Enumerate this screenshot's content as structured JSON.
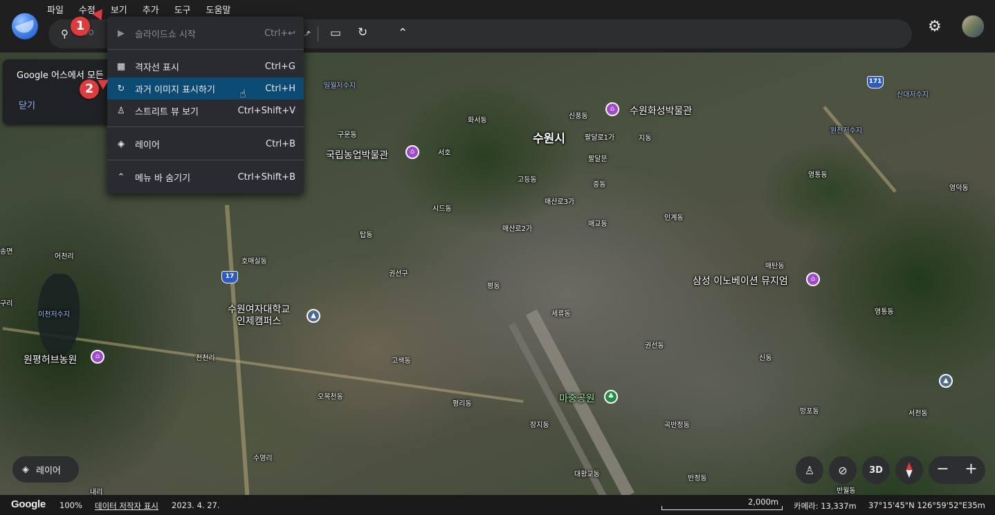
{
  "menubar": {
    "items": [
      "파일",
      "수정",
      "보기",
      "추가",
      "도구",
      "도움말"
    ]
  },
  "search": {
    "placeholder": "Goo"
  },
  "info_panel": {
    "text": "Google 어스에서 모든",
    "close_label": "닫기"
  },
  "view_menu": {
    "items": [
      {
        "icon": "slideshow-icon",
        "label": "슬라이드쇼 시작",
        "shortcut": "Ctrl+↩",
        "disabled": true
      },
      {
        "icon": "grid-icon",
        "label": "격자선 표시",
        "shortcut": "Ctrl+G"
      },
      {
        "icon": "history-icon",
        "label": "과거 이미지 표시하기",
        "shortcut": "Ctrl+H",
        "highlighted": true
      },
      {
        "icon": "pegman-icon",
        "label": "스트리트 뷰 보기",
        "shortcut": "Ctrl+Shift+V"
      },
      {
        "icon": "layers-icon",
        "label": "레이어",
        "shortcut": "Ctrl+B"
      },
      {
        "icon": "chevron-up-icon",
        "label": "메뉴 바 숨기기",
        "shortcut": "Ctrl+Shift+B"
      }
    ]
  },
  "annotations": {
    "marker1": "1",
    "marker2": "2"
  },
  "map_labels": {
    "suwon_city": "수원시",
    "suwon_museum": "수원화성박물관",
    "national_museum": "국립농업박물관",
    "samsung_museum": "삼성 이노베이션 뮤지엄",
    "womens_univ": "수원여자대학교\n인제캠퍼스",
    "herb_farm": "원평허브농원",
    "majung_park": "마중공원",
    "ilwol_reservoir": "일월저수지",
    "sinde_reservoir": "신대저수지",
    "wonchun_reservoir": "원천저수지",
    "icheon_reservoir": "이천저수지",
    "hwaseo": "화서동",
    "sinpung": "신풍동",
    "paldalro1": "팔달로1가",
    "jidong": "지동",
    "gudong": "구운동",
    "seoho": "서호",
    "paldalmun": "팔달문",
    "godeung": "고등동",
    "jungdong": "중동",
    "maesanro3": "매산로3가",
    "sidong": "시드동",
    "maesanro2": "매산로2가",
    "maegyo": "매교동",
    "ingye": "인계동",
    "yeongtong": "영통동",
    "yeongdeok": "영덕동",
    "tapdong": "탑동",
    "homaesil": "호매실동",
    "eocheonri": "어천리",
    "gwonseongu": "권선구",
    "pyeongdong": "평동",
    "seryu": "세류동",
    "maetan": "매탄동",
    "yeongtongdong": "영통동",
    "gwonseon": "권선동",
    "gosaek": "고색동",
    "cheoncheonri": "천천리",
    "sindong": "신동",
    "omokcheon": "오목천동",
    "pyeongri": "평리동",
    "jangji": "장지동",
    "mangpo": "망포동",
    "seocheon": "서천동",
    "gokbanjeong": "곡반정동",
    "sugyeongri": "수영리",
    "daehwang": "대황교동",
    "banjeong": "반정동",
    "naeri": "내리",
    "banwol": "반월동",
    "songmyeon": "송면",
    "guri": "구리",
    "route17": "17",
    "route171": "171"
  },
  "controls": {
    "layers_label": "레이어",
    "view_3d": "3D",
    "zoom_out": "−",
    "zoom_in": "+"
  },
  "status": {
    "logo": "Google",
    "zoom": "100%",
    "credits": "데이터 저작자 표시",
    "date": "2023. 4. 27.",
    "scale": "2,000m",
    "camera": "카메라: 13,337m",
    "coords": "37°15'45\"N 126°59'52\"E",
    "elevation": "35m"
  },
  "colors": {
    "accent": "#8ab4f8",
    "highlight": "#0b4a73",
    "marker": "#e03a3a",
    "poi_museum": "#a246d4",
    "poi_park": "#1e8e3e"
  }
}
